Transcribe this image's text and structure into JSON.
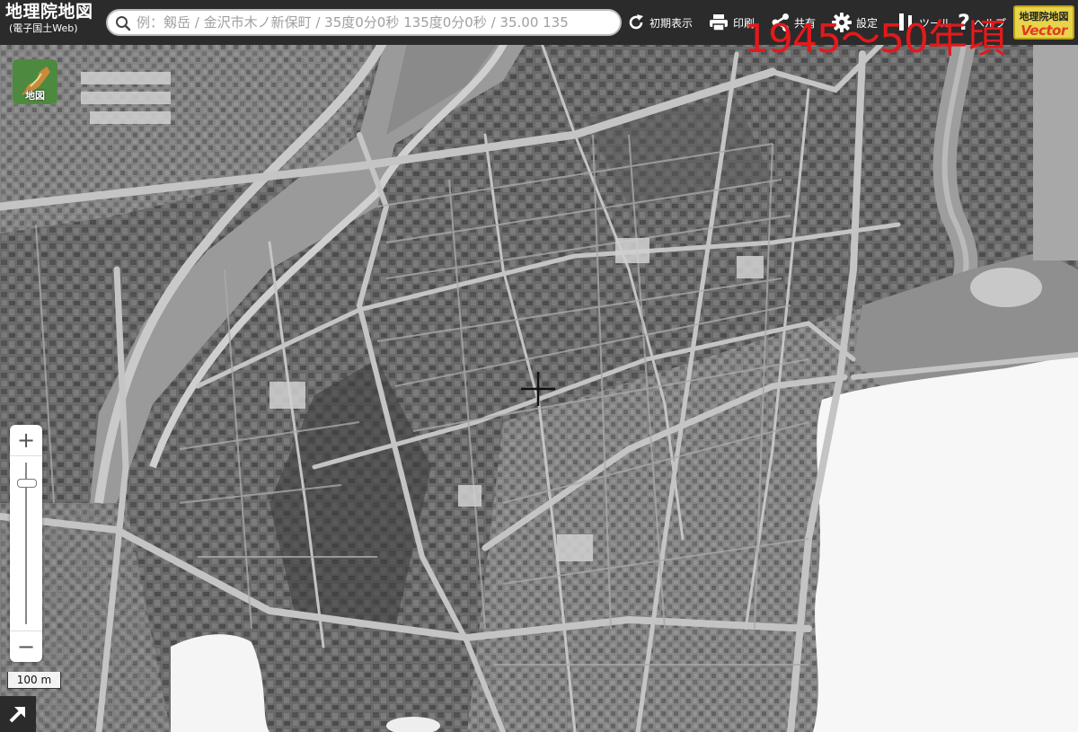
{
  "app": {
    "title": "地理院地図",
    "subtitle": "(電子国土Web)"
  },
  "search": {
    "placeholder": "例：剱岳 / 金沢市木ノ新保町 / 35度0分0秒 135度0分0秒 / 35.00 135"
  },
  "toolbar": {
    "reset_label": "初期表示",
    "print_label": "印刷",
    "share_label": "共有",
    "settings_label": "設定",
    "tools_label": "ツール",
    "help_label": "ヘルプ"
  },
  "badge": {
    "top": "地理院地図",
    "bottom": "Vector"
  },
  "overlay": {
    "period_label": "1945〜50年頃"
  },
  "layer_button": {
    "label": "地図"
  },
  "zoom": {
    "in_label": "+",
    "out_label": "−"
  },
  "scale": {
    "label": "100 m"
  },
  "colors": {
    "header_bg": "#2b2b2b",
    "period_label": "#e5181b",
    "badge_bg": "#e8d44a",
    "badge_vector": "#e23a22"
  }
}
